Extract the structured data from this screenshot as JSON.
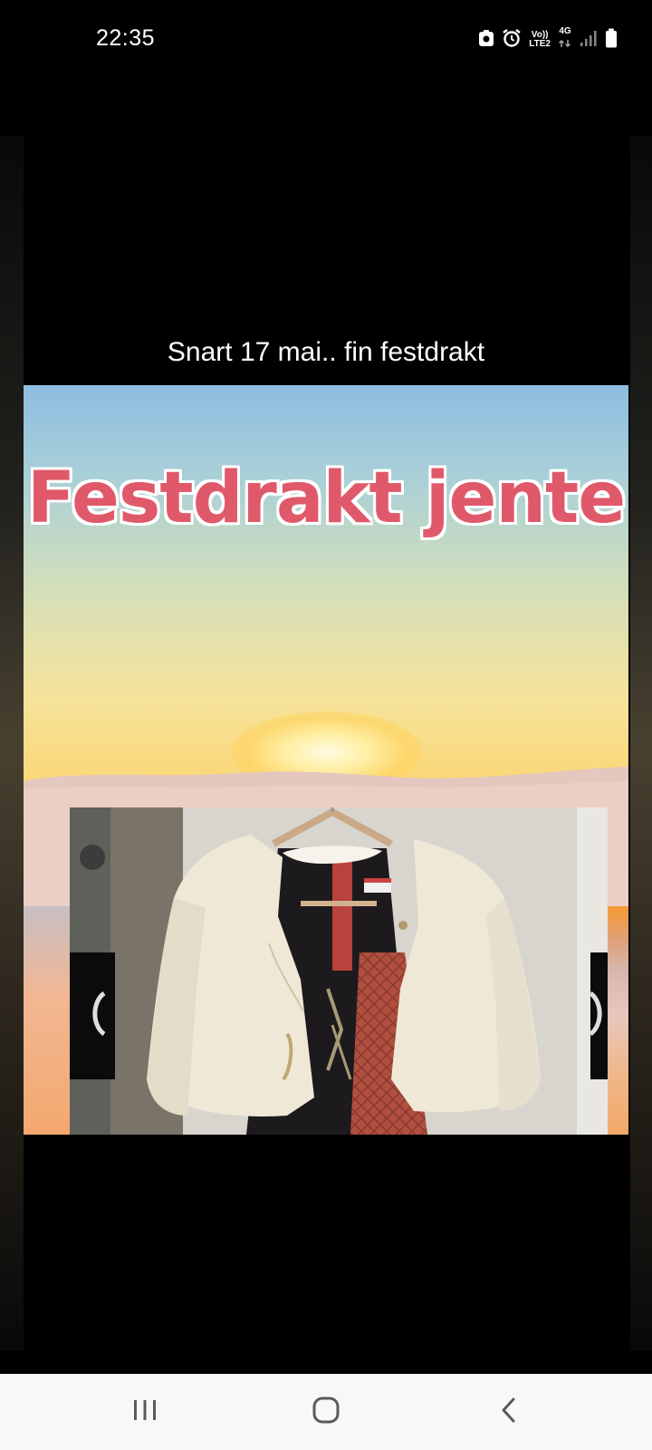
{
  "status_bar": {
    "time": "22:35",
    "network_top": "Vo))",
    "network_bottom": "LTE2",
    "data_type": "4G",
    "icons": [
      "screenshot-icon",
      "alarm-icon",
      "volte-icon",
      "data-arrows-icon",
      "signal-icon",
      "battery-icon"
    ]
  },
  "story": {
    "caption": "Snart 17 mai.. fin festdrakt",
    "hero_title": "Festdrakt jente"
  },
  "nav_bar": {
    "buttons": [
      "recent-apps-icon",
      "home-icon",
      "back-icon"
    ]
  }
}
